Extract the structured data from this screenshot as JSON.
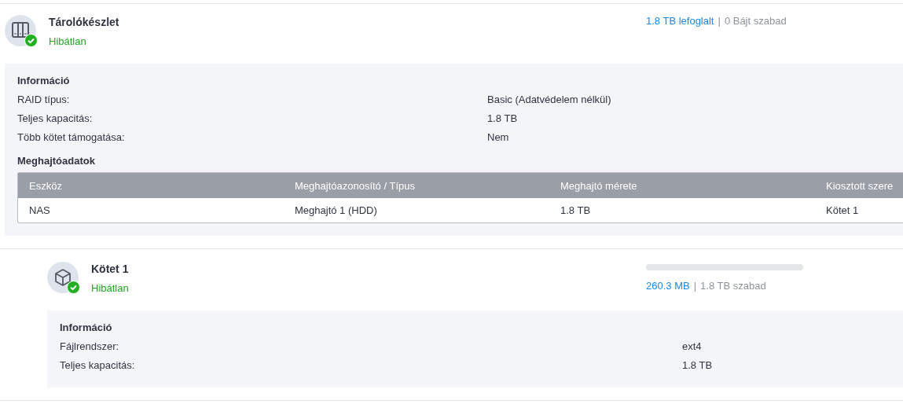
{
  "pool": {
    "title": "Tárolókészlet",
    "status": "Hibátlan",
    "healthy": true,
    "usage": {
      "used": "1.8 TB lefoglalt",
      "separator": "|",
      "free": "0 Bájt szabad"
    },
    "info": {
      "heading": "Információ",
      "rows": [
        {
          "label": "RAID típus:",
          "value": "Basic (Adatvédelem nélkül)"
        },
        {
          "label": "Teljes kapacitás:",
          "value": "1.8 TB"
        },
        {
          "label": "Több kötet támogatása:",
          "value": "Nem"
        }
      ]
    },
    "drives": {
      "heading": "Meghajtóadatok",
      "columns": [
        "Eszköz",
        "Meghajtóazonosító / Típus",
        "Meghajtó mérete",
        "Kiosztott szere"
      ],
      "rows": [
        [
          "NAS",
          "Meghajtó 1 (HDD)",
          "1.8 TB",
          "Kötet 1"
        ]
      ]
    }
  },
  "volume": {
    "title": "Kötet 1",
    "status": "Hibátlan",
    "healthy": true,
    "level": 0.0,
    "usage": {
      "used": "260.3 MB",
      "separator": "|",
      "free": "1.8 TB szabad"
    },
    "info": {
      "heading": "Információ",
      "rows": [
        {
          "label": "Fájlrendszer:",
          "value": "ext4"
        },
        {
          "label": "Teljes kapacitás:",
          "value": "1.8 TB"
        }
      ]
    }
  }
}
